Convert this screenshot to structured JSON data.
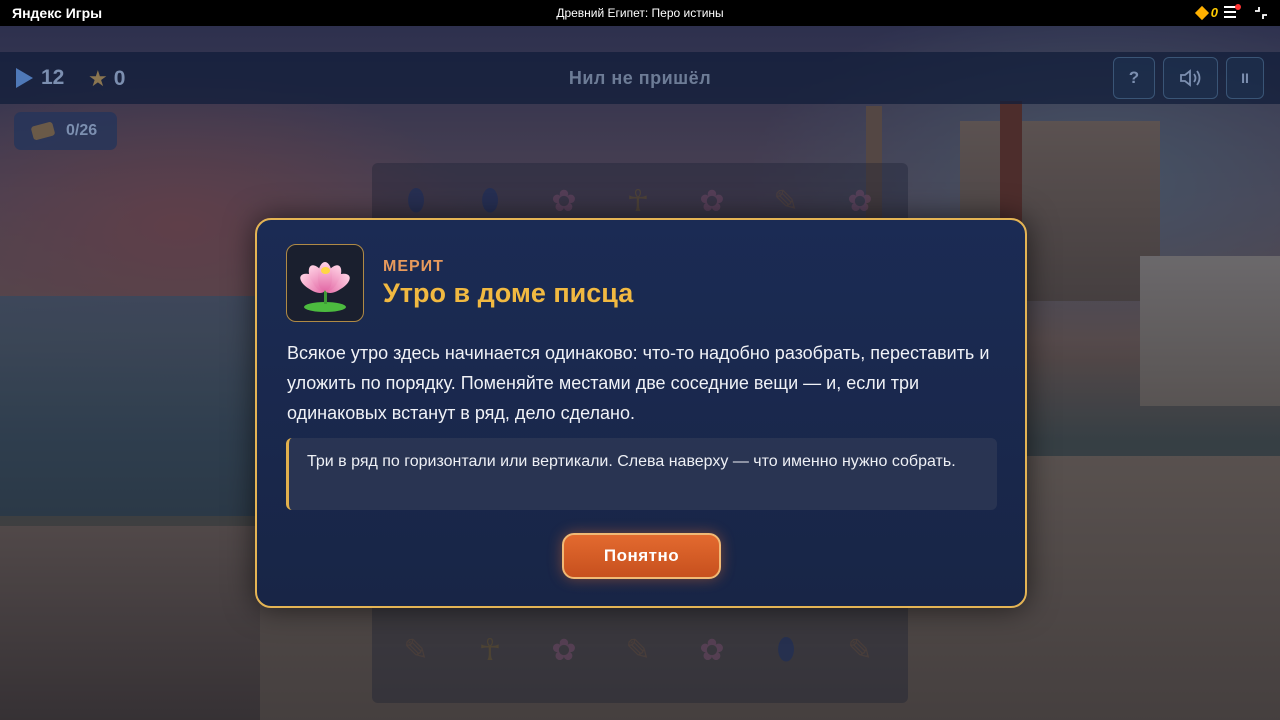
{
  "platform": {
    "logo_text": "Яндекс Игры",
    "game_title": "Древний Египет: Перо истины",
    "coins": "0"
  },
  "hud": {
    "moves": "12",
    "stars": "0",
    "level_name": "Нил не пришёл",
    "help_label": "?",
    "sound_icon": "speaker-icon",
    "pause_label": "II"
  },
  "goal": {
    "item_icon": "scroll-icon",
    "progress": "0/26"
  },
  "board": {
    "row_top": [
      "scarab",
      "scarab",
      "lotus",
      "ankh",
      "lotus",
      "scroll",
      "lotus"
    ],
    "row_bottom": [
      "scroll",
      "ankh",
      "lotus",
      "scroll",
      "lotus",
      "scarab",
      "scroll"
    ]
  },
  "dialog": {
    "portrait_icon": "lotus-icon",
    "speaker": "МЕРИТ",
    "title": "Утро в доме писца",
    "body": "Всякое утро здесь начинается одинаково: что-то надобно разобрать, переставить и уложить по порядку. Поменяйте местами две соседние вещи — и, если три одинаковых встанут в ряд, дело сделано.",
    "hint": "Три в ряд по горизонтали или вертикали. Слева наверху — что именно нужно собрать.",
    "ok_label": "Понятно"
  },
  "colors": {
    "accent_gold": "#e4b454",
    "button_orange": "#d85d26",
    "dialog_bg": "#1b2b54"
  }
}
